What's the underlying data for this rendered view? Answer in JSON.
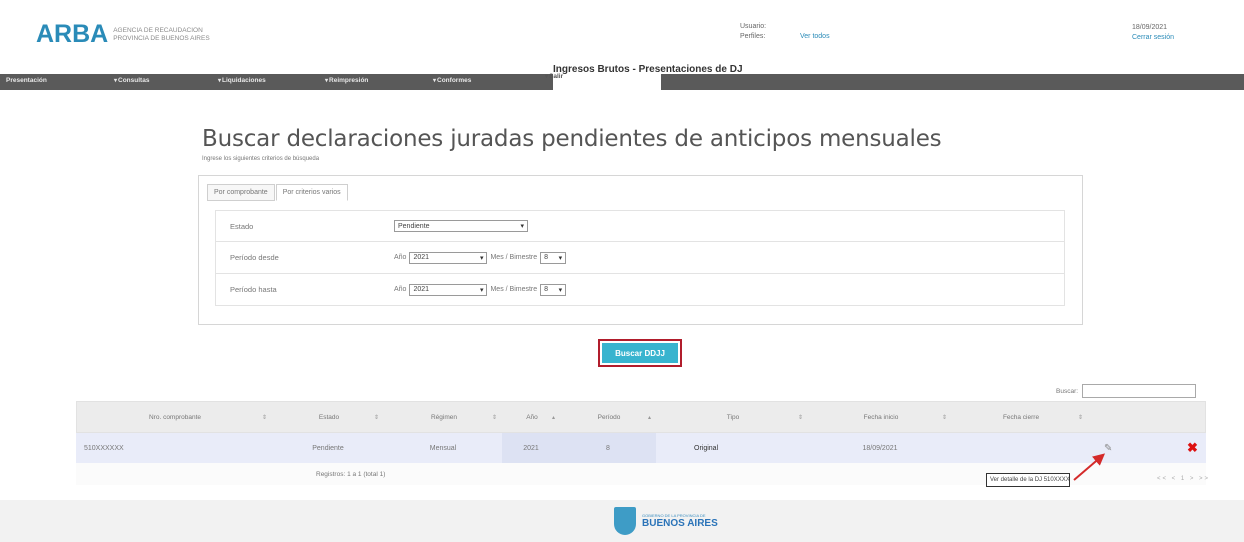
{
  "header": {
    "logo": "ARBA",
    "agency_line1": "AGENCIA DE RECAUDACION",
    "agency_line2": "PROVINCIA DE BUENOS AIRES",
    "usuario_label": "Usuario:",
    "perfiles_label": "Perfiles:",
    "ver_todos": "Ver todos",
    "date": "18/09/2021",
    "logout": "Cerrar sesión"
  },
  "app_title": "Ingresos Brutos - Presentaciones de DJ",
  "nav": {
    "items": [
      "Presentación",
      "Consultas",
      "Liquidaciones",
      "Reimpresión",
      "Conformes",
      "Salir"
    ]
  },
  "main": {
    "title": "Buscar declaraciones juradas pendientes de anticipos mensuales",
    "subtitle": "Ingrese los siguientes criterios de búsqueda",
    "tabs": [
      "Por comprobante",
      "Por criterios varios"
    ],
    "criteria": {
      "estado_label": "Estado",
      "estado_value": "Pendiente",
      "desde_label": "Período desde",
      "hasta_label": "Período hasta",
      "anio_label": "Año",
      "anio_value": "2021",
      "mes_label": "Mes / Bimestre",
      "mes_value": "8"
    },
    "search_button": "Buscar DDJJ"
  },
  "table": {
    "buscar_label": "Buscar:",
    "columns": [
      "Nro. comprobante",
      "Estado",
      "Régimen",
      "Año",
      "Período",
      "Tipo",
      "Fecha inicio",
      "Fecha cierre"
    ],
    "rows": [
      [
        "510XXXXXX",
        "Pendiente",
        "Mensual",
        "2021",
        "8",
        "Original",
        "18/09/2021",
        ""
      ]
    ],
    "footer_text": "Registros: 1 a 1 (total 1)",
    "tooltip": "Ver detalle de la DJ 510XXXXXX",
    "pager": "<< < 1 > >>",
    "pencil_icon": "pencil-icon",
    "delete_icon": "delete-icon"
  },
  "footer": {
    "gov_line": "GOBIERNO DE LA PROVINCIA DE",
    "province": "BUENOS AIRES"
  },
  "colors": {
    "brand": "#2a8bb8",
    "button": "#38b4cf",
    "highlight_border": "#b11d2c",
    "delete": "#dd1111"
  }
}
